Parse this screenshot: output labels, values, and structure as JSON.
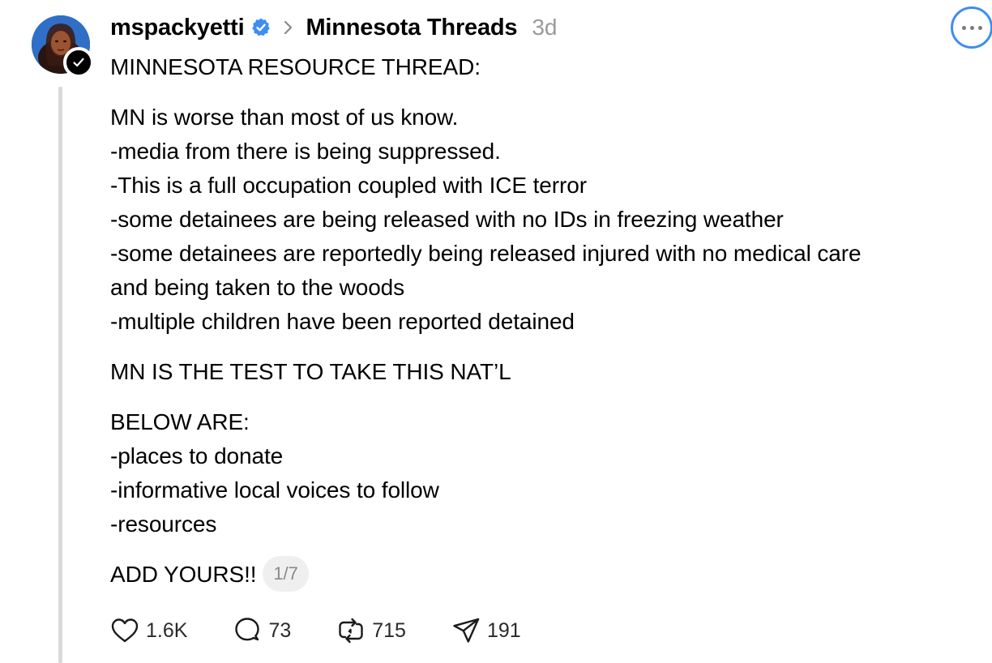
{
  "post": {
    "username": "mspackyetti",
    "topic": "Minnesota Threads",
    "time": "3d",
    "lines": [
      "MINNESOTA RESOURCE THREAD:",
      "MN is worse than most of us know.",
      "-media from there is being suppressed.",
      "-This is a full occupation coupled with ICE terror",
      "-some detainees are being released with no IDs in freezing weather",
      "-some detainees are reportedly being released injured with no medical care",
      "and being taken to the woods",
      "-multiple children have been reported detained",
      "MN IS THE TEST TO TAKE THIS NAT’L",
      "BELOW ARE:",
      "-places to donate",
      "-informative local voices to follow",
      "-resources",
      "ADD YOURS!!"
    ],
    "page_indicator": "1/7"
  },
  "actions": {
    "likes": "1.6K",
    "replies": "73",
    "reposts": "715",
    "shares": "191"
  },
  "icons": {
    "verified": "verified-badge-icon",
    "chevron": "chevron-right-icon",
    "more": "more-options-icon",
    "like": "heart-icon",
    "reply": "comment-icon",
    "repost": "repost-icon",
    "share": "send-icon"
  },
  "colors": {
    "verified_blue": "#3d8ef0",
    "muted_text": "#9a9a9a",
    "thread_line": "#d9d9d9"
  }
}
